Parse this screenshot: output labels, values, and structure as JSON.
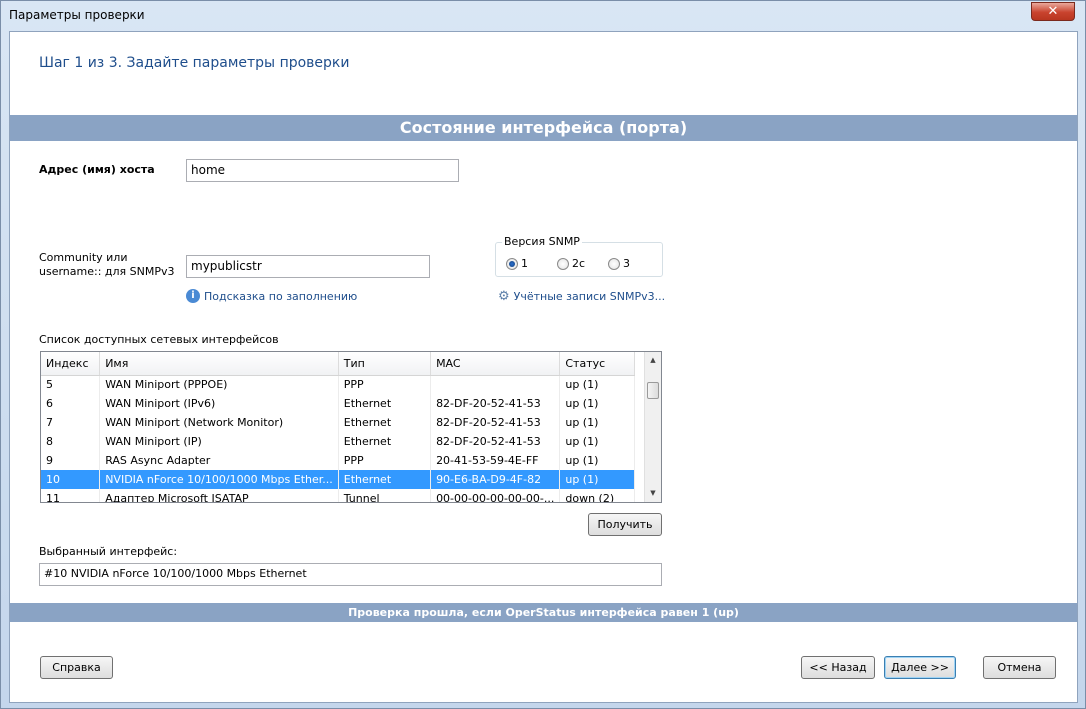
{
  "window": {
    "title": "Параметры проверки",
    "close_glyph": "✕"
  },
  "header": {
    "step": "Шаг 1 из 3. Задайте параметры проверки"
  },
  "section_title": "Состояние интерфейса (порта)",
  "host": {
    "label": "Адрес (имя) хоста",
    "value": "home"
  },
  "community": {
    "label_line1": "Community или",
    "label_line2": "username:: для SNMPv3",
    "value": "mypublicstr"
  },
  "hint_link": "Подсказка по заполнению",
  "snmp": {
    "legend": "Версия SNMP",
    "options": [
      "1",
      "2c",
      "3"
    ],
    "selected": "1",
    "accounts_link": "Учётные записи SNMPv3..."
  },
  "interfaces": {
    "label": "Список доступных сетевых интерфейсов",
    "columns": [
      "Индекс",
      "Имя",
      "Тип",
      "MAC",
      "Статус"
    ],
    "rows": [
      [
        "5",
        "WAN Miniport (PPPOE)",
        "PPP",
        "",
        "up (1)"
      ],
      [
        "6",
        "WAN Miniport (IPv6)",
        "Ethernet",
        "82-DF-20-52-41-53",
        "up (1)"
      ],
      [
        "7",
        "WAN Miniport (Network Monitor)",
        "Ethernet",
        "82-DF-20-52-41-53",
        "up (1)"
      ],
      [
        "8",
        "WAN Miniport (IP)",
        "Ethernet",
        "82-DF-20-52-41-53",
        "up (1)"
      ],
      [
        "9",
        "RAS Async Adapter",
        "PPP",
        "20-41-53-59-4E-FF",
        "up (1)"
      ],
      [
        "10",
        "NVIDIA nForce 10/100/1000 Mbps Ether...",
        "Ethernet",
        "90-E6-BA-D9-4F-82",
        "up (1)"
      ],
      [
        "11",
        "Адаптер Microsoft ISATAP",
        "Tunnel",
        "00-00-00-00-00-00-...",
        "down (2)"
      ]
    ],
    "selected_index": 5,
    "get_button": "Получить"
  },
  "selected_interface": {
    "label": "Выбранный интерфейс:",
    "value": "#10 NVIDIA nForce 10/100/1000 Mbps Ethernet"
  },
  "footer_note": "Проверка прошла, если OperStatus интерфейса равен 1 (up)",
  "buttons": {
    "help": "Справка",
    "back": "<< Назад",
    "next": "Далее >>",
    "cancel": "Отмена"
  },
  "colors": {
    "band": "#8aa3c4",
    "selection": "#3399ff",
    "title_text": "#1f4e8c"
  }
}
